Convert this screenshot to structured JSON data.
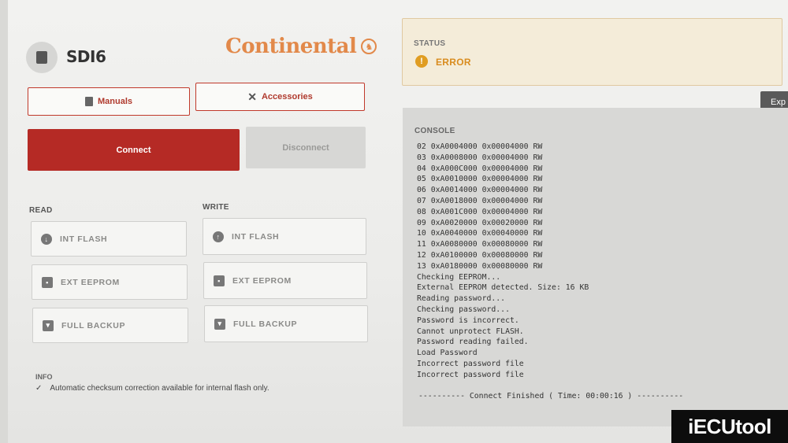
{
  "device": {
    "name": "SDI6",
    "chip_icon": "chip-icon"
  },
  "brand": {
    "name": "Continental",
    "color": "#e2894a"
  },
  "buttons": {
    "manuals": "Manuals",
    "accessories": "Accessories",
    "connect": "Connect",
    "disconnect": "Disconnect"
  },
  "read": {
    "label": "READ",
    "items": [
      {
        "label": "INT FLASH",
        "icon": "download-icon"
      },
      {
        "label": "EXT EEPROM",
        "icon": "chip-icon"
      },
      {
        "label": "FULL BACKUP",
        "icon": "save-icon"
      }
    ]
  },
  "write": {
    "label": "WRITE",
    "items": [
      {
        "label": "INT FLASH",
        "icon": "upload-icon"
      },
      {
        "label": "EXT EEPROM",
        "icon": "chip-icon"
      },
      {
        "label": "FULL BACKUP",
        "icon": "save-icon"
      }
    ]
  },
  "info": {
    "label": "INFO",
    "check": "✓",
    "text": "Automatic checksum correction available for internal flash only."
  },
  "status": {
    "label": "STATUS",
    "value": "ERROR",
    "icon": "!",
    "color": "#e09d22"
  },
  "export_label": "Exp",
  "console": {
    "label": "CONSOLE",
    "lines": [
      "02 0xA0004000 0x00004000 RW",
      "03 0xA0008000 0x00004000 RW",
      "04 0xA000C000 0x00004000 RW",
      "05 0xA0010000 0x00004000 RW",
      "06 0xA0014000 0x00004000 RW",
      "07 0xA0018000 0x00004000 RW",
      "08 0xA001C000 0x00004000 RW",
      "09 0xA0020000 0x00020000 RW",
      "10 0xA0040000 0x00040000 RW",
      "11 0xA0080000 0x00080000 RW",
      "12 0xA0100000 0x00080000 RW",
      "13 0xA0180000 0x00080000 RW",
      "Checking EEPROM...",
      "External EEPROM detected. Size: 16 KB",
      "Reading password...",
      "Checking password...",
      "Password is incorrect.",
      "Cannot unprotect FLASH.",
      "Password reading failed.",
      "Load Password",
      "Incorrect password file",
      "Incorrect password file"
    ],
    "footer": "---------- Connect Finished ( Time: 00:00:16 ) ----------"
  },
  "watermark": "iECUtool"
}
